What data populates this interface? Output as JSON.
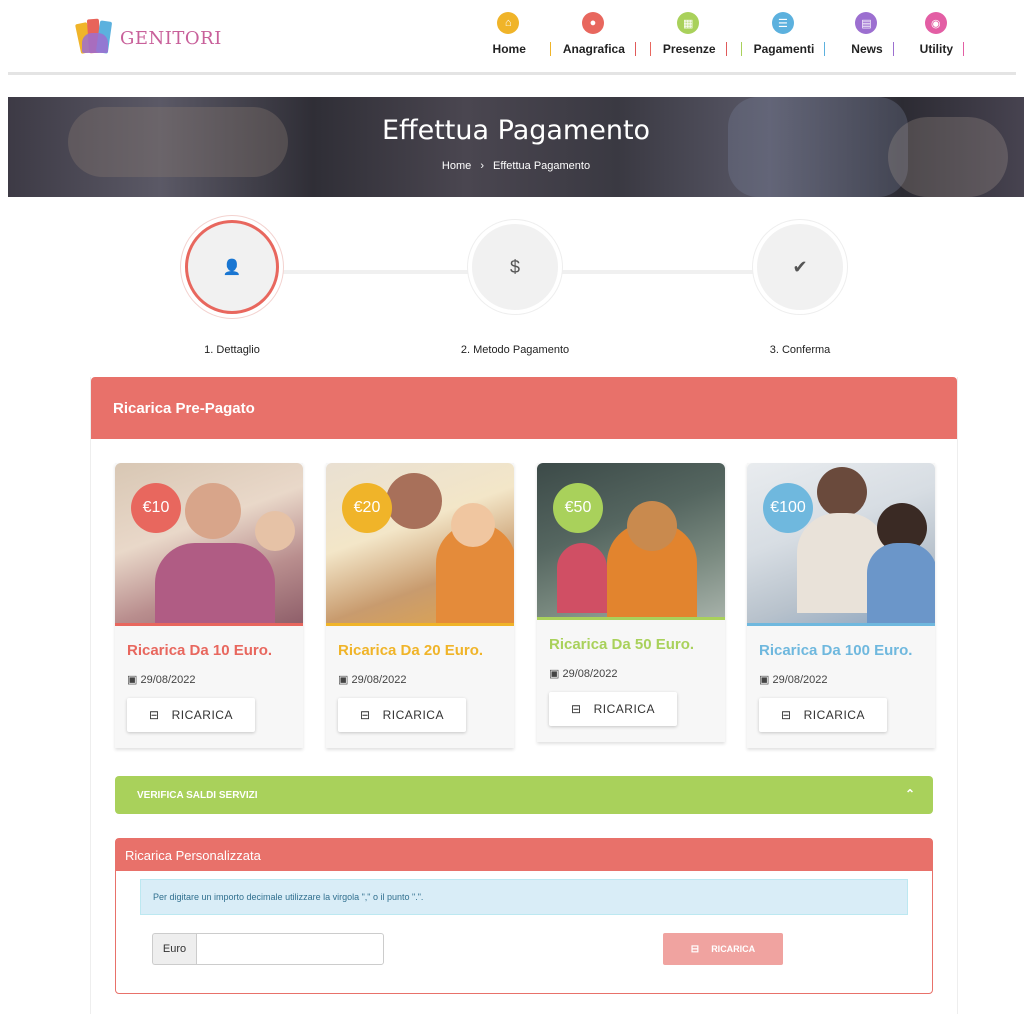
{
  "app": {
    "logo_text": "GENITORI"
  },
  "nav": [
    {
      "label": "Home",
      "icon": "home-icon",
      "color": "#f0b429"
    },
    {
      "label": "Anagrafica",
      "icon": "user-icon",
      "color": "#e8675e"
    },
    {
      "label": "Presenze",
      "icon": "calendar-icon",
      "color": "#a9d15b"
    },
    {
      "label": "Pagamenti",
      "icon": "list-icon",
      "color": "#5cb1de"
    },
    {
      "label": "News",
      "icon": "newspaper-icon",
      "color": "#9c6fd0"
    },
    {
      "label": "Utility",
      "icon": "eye-icon",
      "color": "#e35ea4"
    }
  ],
  "hero": {
    "title": "Effettua Pagamento",
    "breadcrumb": [
      "Home",
      "Effettua Pagamento"
    ],
    "separator": "›"
  },
  "steps": [
    {
      "label": "1. Dettaglio",
      "icon": "user-icon",
      "symbol": "👤"
    },
    {
      "label": "2. Metodo Pagamento",
      "icon": "dollar-icon",
      "symbol": "$"
    },
    {
      "label": "3. Conferma",
      "icon": "check-icon",
      "symbol": "✔"
    }
  ],
  "panel": {
    "title": "Ricarica Pre-Pagato"
  },
  "cards": [
    {
      "price": "€10",
      "title": "Ricarica Da 10 Euro.",
      "date": "29/08/2022",
      "button": "RICARICA",
      "color": "#e8675e"
    },
    {
      "price": "€20",
      "title": "Ricarica Da 20 Euro.",
      "date": "29/08/2022",
      "button": "RICARICA",
      "color": "#f0b429"
    },
    {
      "price": "€50",
      "title": "Ricarica Da 50 Euro.",
      "date": "29/08/2022",
      "button": "RICARICA",
      "color": "#a9d15b"
    },
    {
      "price": "€100",
      "title": "Ricarica Da 100 Euro.",
      "date": "29/08/2022",
      "button": "RICARICA",
      "color": "#6fb8de"
    }
  ],
  "verify": {
    "label": "VERIFICA SALDI SERVIZI",
    "icon": "chevron-up-icon"
  },
  "custom": {
    "title": "Ricarica Personalizzata",
    "info": "Per digitare un importo decimale utilizzare la virgola \",\" o il punto \".\".",
    "euro_label": "Euro",
    "input_value": "",
    "input_placeholder": "",
    "button": "RICARICA"
  }
}
